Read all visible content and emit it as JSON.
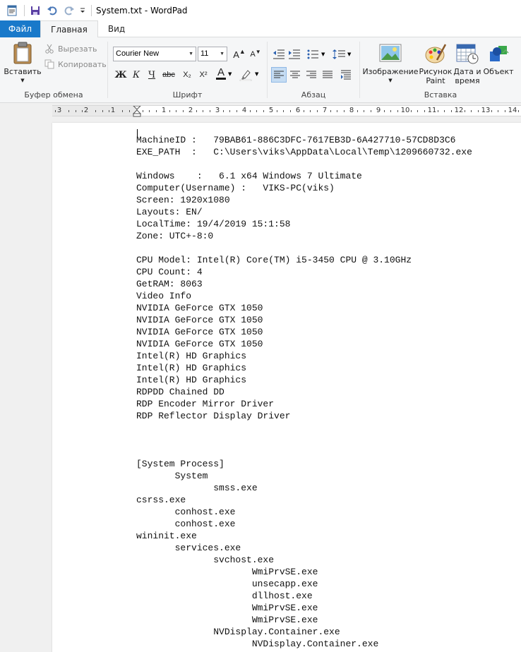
{
  "titlebar": {
    "title": "System.txt - WordPad",
    "quick_access": [
      "app-icon",
      "save-icon",
      "undo-icon",
      "redo-icon",
      "customize-icon"
    ]
  },
  "tabs": [
    {
      "label": "Файл"
    },
    {
      "label": "Главная"
    },
    {
      "label": "Вид"
    }
  ],
  "clipboard": {
    "paste": "Вставить",
    "cut": "Вырезать",
    "copy": "Копировать",
    "group": "Буфер обмена"
  },
  "font": {
    "family": "Courier New",
    "size": "11",
    "group": "Шрифт",
    "bold": "Ж",
    "italic": "К",
    "underline": "Ч",
    "strike": "abc",
    "subscript": "X₂",
    "superscript": "X²",
    "color_letter": "A",
    "grow": "A",
    "shrink": "A",
    "font_color": "#1a1a1a",
    "highlight_color": "#ffffff"
  },
  "paragraph": {
    "group": "Абзац"
  },
  "insert": {
    "group": "Вставка",
    "picture": "Изображение",
    "paint_line1": "Рисунок",
    "paint_line2": "Paint",
    "datetime_line1": "Дата и",
    "datetime_line2": "время",
    "object": "Объект"
  },
  "ruler": {
    "labels": [
      "3",
      "2",
      "1",
      "1",
      "2",
      "3",
      "4",
      "5",
      "6",
      "7",
      "8",
      "9",
      "10",
      "11",
      "12",
      "13",
      "14"
    ]
  },
  "document": {
    "lines": [
      "MachineID :   79BAB61-886C3DFC-7617EB3D-6A427710-57CD8D3C6",
      "EXE_PATH  :   C:\\Users\\viks\\AppData\\Local\\Temp\\1209660732.exe",
      "",
      "Windows    :   6.1 x64 Windows 7 Ultimate",
      "Computer(Username) :   VIKS-PC(viks)",
      "Screen: 1920x1080",
      "Layouts: EN/",
      "LocalTime: 19/4/2019 15:1:58",
      "Zone: UTC+-8:0",
      "",
      "CPU Model: Intel(R) Core(TM) i5-3450 CPU @ 3.10GHz",
      "CPU Count: 4",
      "GetRAM: 8063",
      "Video Info",
      "NVIDIA GeForce GTX 1050",
      "NVIDIA GeForce GTX 1050",
      "NVIDIA GeForce GTX 1050",
      "NVIDIA GeForce GTX 1050",
      "Intel(R) HD Graphics",
      "Intel(R) HD Graphics",
      "Intel(R) HD Graphics",
      "RDPDD Chained DD",
      "RDP Encoder Mirror Driver",
      "RDP Reflector Display Driver",
      "",
      "",
      "",
      "[System Process]",
      "       System",
      "              smss.exe",
      "csrss.exe",
      "       conhost.exe",
      "       conhost.exe",
      "wininit.exe",
      "       services.exe",
      "              svchost.exe",
      "                     WmiPrvSE.exe",
      "                     unsecapp.exe",
      "                     dllhost.exe",
      "                     WmiPrvSE.exe",
      "                     WmiPrvSE.exe",
      "              NVDisplay.Container.exe",
      "                     NVDisplay.Container.exe"
    ]
  }
}
